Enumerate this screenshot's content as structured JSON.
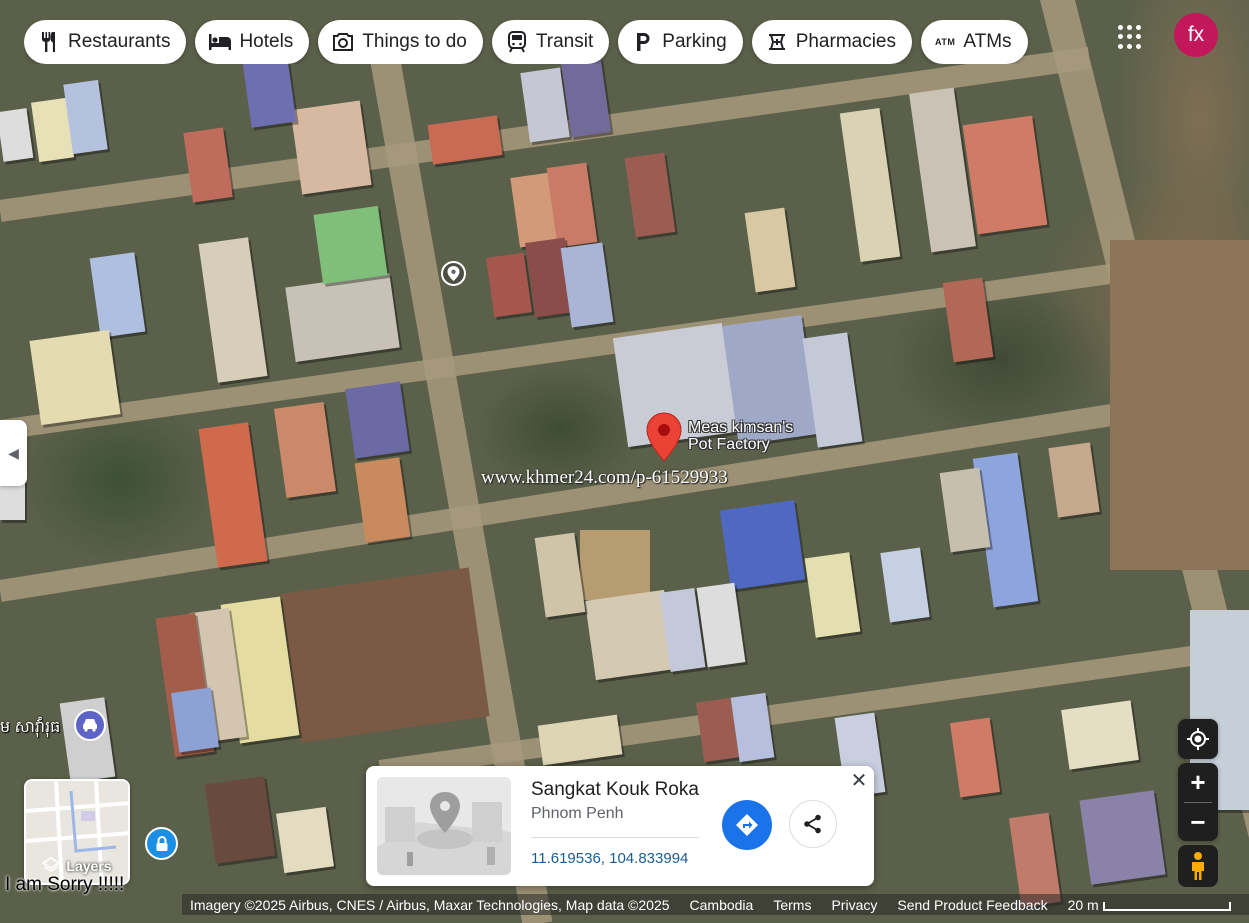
{
  "chips": [
    {
      "label": "Restaurants",
      "icon": "restaurant-icon"
    },
    {
      "label": "Hotels",
      "icon": "hotel-bed-icon"
    },
    {
      "label": "Things to do",
      "icon": "camera-icon"
    },
    {
      "label": "Transit",
      "icon": "transit-icon"
    },
    {
      "label": "Parking",
      "icon": "parking-icon"
    },
    {
      "label": "Pharmacies",
      "icon": "pharmacy-icon"
    },
    {
      "label": "ATMs",
      "icon": "atm-icon"
    }
  ],
  "account": {
    "initials": "fx",
    "color": "#c2185b"
  },
  "map": {
    "place_label_line1": "Meas kimsan's",
    "place_label_line2": "Pot Factory",
    "watermark": "www.khmer24.com/p-61529933",
    "khmer_label": "ម សាវ៉ាំរុធ",
    "overlay_text": "I am Sorry !!!!!"
  },
  "layers": {
    "label": "Layers"
  },
  "info_card": {
    "title": "Sangkat Kouk Roka",
    "subtitle": "Phnom Penh",
    "coordinates": "11.619536, 104.833994",
    "directions_color": "#1a73e8"
  },
  "footer": {
    "imagery": "Imagery ©2025 Airbus, CNES / Airbus, Maxar Technologies, Map data ©2025",
    "country": "Cambodia",
    "terms": "Terms",
    "privacy": "Privacy",
    "feedback": "Send Product Feedback",
    "scale": "20 m"
  }
}
